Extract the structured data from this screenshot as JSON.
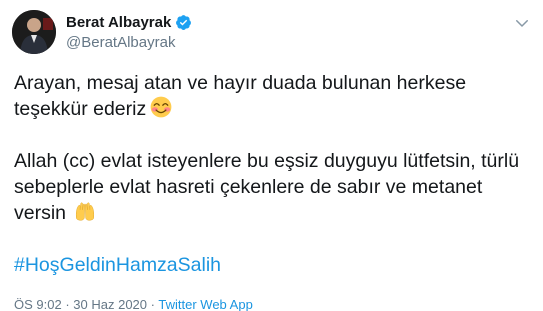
{
  "author": {
    "display_name": "Berat Albayrak",
    "handle": "@BeratAlbayrak",
    "verified": true
  },
  "tweet": {
    "paragraph_1": "Arayan, mesaj atan ve hayır duada bulunan herkese teşekkür ederiz",
    "paragraph_1_emoji": "smiling-face-icon",
    "paragraph_2": "Allah (cc) evlat isteyenlere bu eşsiz duyguyu lütfetsin, türlü sebeplerle evlat hasreti çekenlere de sabır ve metanet versin",
    "paragraph_2_emoji": "raised-hands-icon",
    "hashtag": "#HoşGeldinHamzaSalih"
  },
  "meta": {
    "time": "ÖS 9:02",
    "separator": "·",
    "date": "30 Haz 2020",
    "source": "Twitter Web App"
  },
  "colors": {
    "link": "#1b95e0",
    "secondary_text": "#657786",
    "primary_text": "#14171a",
    "verified": "#1da1f2"
  }
}
